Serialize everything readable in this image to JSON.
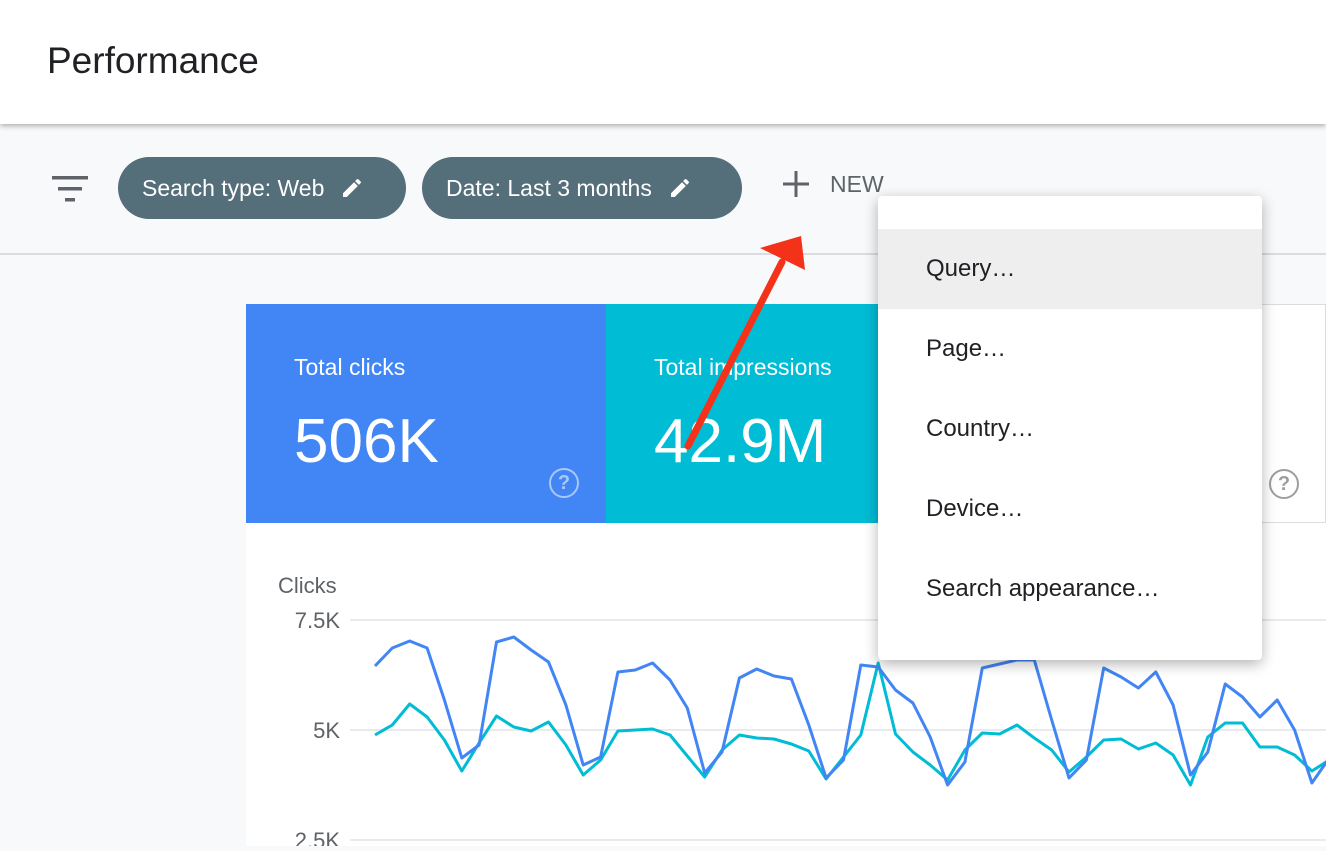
{
  "header": {
    "title": "Performance"
  },
  "filters": {
    "icon": "filter-list-icon",
    "chips": [
      {
        "label": "Search type: Web",
        "icon": "pencil-icon"
      },
      {
        "label": "Date: Last 3 months",
        "icon": "pencil-icon"
      }
    ],
    "new_label": "NEW",
    "new_icon": "plus-icon"
  },
  "menu": {
    "items": [
      {
        "label": "Query…",
        "highlighted": true
      },
      {
        "label": "Page…"
      },
      {
        "label": "Country…"
      },
      {
        "label": "Device…"
      },
      {
        "label": "Search appearance…"
      }
    ]
  },
  "cards": [
    {
      "label": "Total clicks",
      "value": "506K",
      "color": "#4285f4"
    },
    {
      "label": "Total impressions",
      "value": "42.9M",
      "color": "#00bcd4"
    }
  ],
  "annotation": {
    "arrow_color": "#f4321a"
  },
  "chart_data": {
    "type": "line",
    "ylabel": "Clicks",
    "yticks": [
      "7.5K",
      "5K",
      "2.5K"
    ],
    "ylim": [
      2500,
      7500
    ],
    "grid": true,
    "series": [
      {
        "color": "#4285f4",
        "values": [
          6455,
          6864,
          7023,
          6864,
          5682,
          4364,
          4659,
          7000,
          7114,
          6818,
          6545,
          5568,
          4205,
          4386,
          6318,
          6364,
          6523,
          6136,
          5500,
          4023,
          4500,
          6182,
          6386,
          6227,
          6159,
          5114,
          3909,
          4318,
          6477,
          6432,
          5909,
          5614,
          4841,
          3750,
          4273,
          6409,
          6500,
          6591,
          6591,
          5227,
          3909,
          4318,
          6409,
          6205,
          5955,
          6318,
          5568,
          3977,
          4500,
          6045,
          5750,
          5295,
          5682,
          5000,
          3795,
          4364
        ]
      },
      {
        "color": "#00bcd4",
        "values": [
          4886,
          5114,
          5591,
          5295,
          4773,
          4068,
          4705,
          5318,
          5068,
          4977,
          5182,
          4659,
          3977,
          4318,
          4977,
          5000,
          5023,
          4886,
          4409,
          3932,
          4545,
          4886,
          4818,
          4795,
          4682,
          4523,
          3886,
          4386,
          4886,
          6523,
          4909,
          4500,
          4205,
          3864,
          4545,
          4932,
          4909,
          5114,
          4818,
          4545,
          4045,
          4386,
          4773,
          4795,
          4568,
          4705,
          4432,
          3750,
          4841,
          5159,
          5159,
          4614,
          4614,
          4432,
          4068,
          4318
        ]
      }
    ]
  }
}
